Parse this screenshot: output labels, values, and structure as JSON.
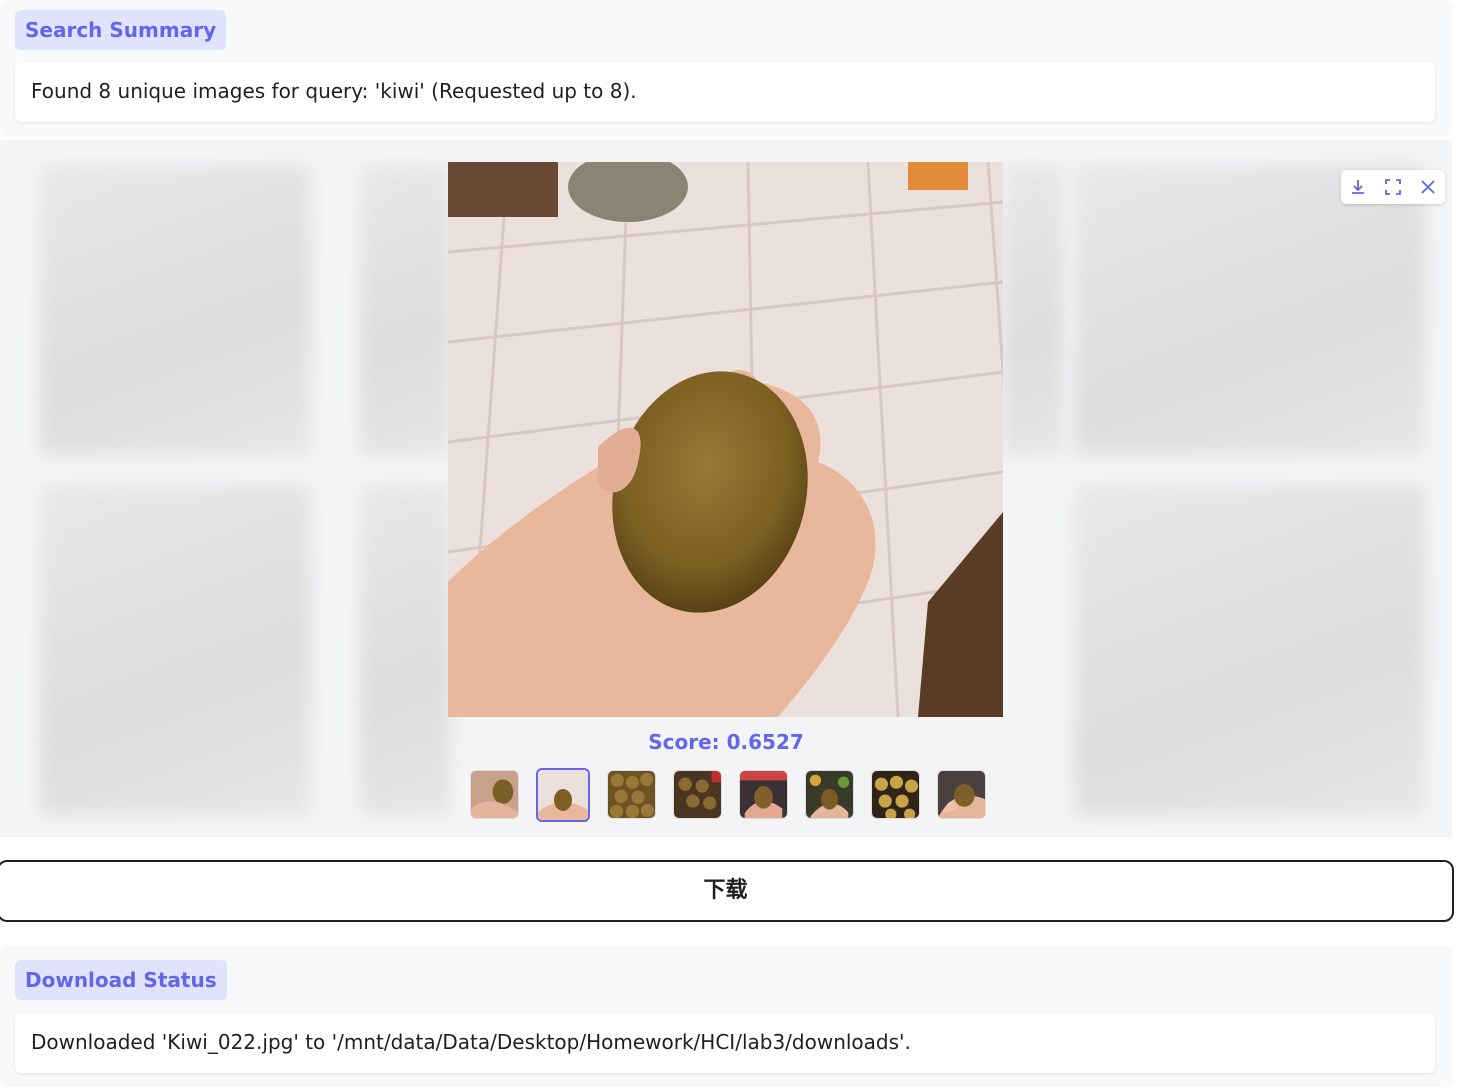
{
  "search_summary": {
    "label": "Search Summary",
    "text": "Found 8 unique images for query: 'kiwi' (Requested up to 8)."
  },
  "gallery": {
    "score_text": "Score: 0.6527",
    "selected_index": 1,
    "thumbnail_count": 8,
    "toolbar": {
      "download_icon": "download-icon",
      "fullscreen_icon": "fullscreen-icon",
      "close_icon": "close-icon"
    }
  },
  "download_button": {
    "label": "下载"
  },
  "download_status": {
    "label": "Download Status",
    "text": "Downloaded 'Kiwi_022.jpg' to '/mnt/data/Data/Desktop/Homework/HCI/lab3/downloads'."
  },
  "colors": {
    "accent": "#6366e8",
    "pill_bg": "#e0e3fb"
  }
}
